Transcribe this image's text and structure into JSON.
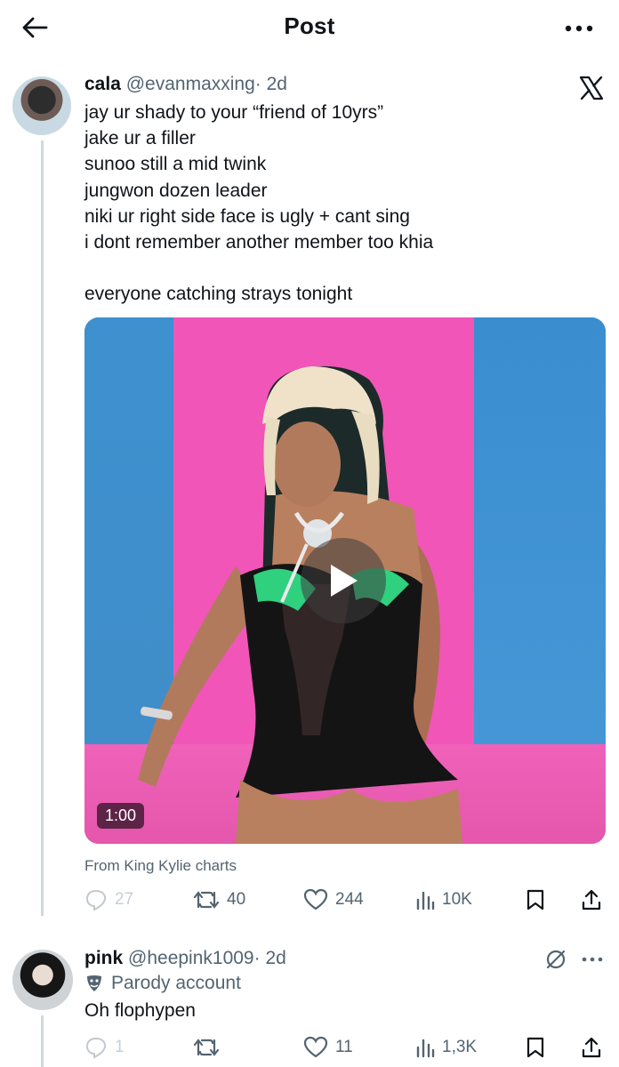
{
  "header": {
    "title": "Post"
  },
  "post": {
    "author_name": "cala",
    "author_handle": "@evanmaxxing",
    "time": "· 2d",
    "text": "jay ur shady to your “friend of 10yrs”\njake ur a filler\nsunoo still a mid twink\njungwon dozen leader\nniki ur right side face is ugly + cant sing\ni dont remember another member too khia\n\neveryone catching strays tonight",
    "media": {
      "duration": "1:00"
    },
    "from_text": "From King Kylie charts",
    "stats": {
      "replies": "27",
      "reposts": "40",
      "likes": "244",
      "views": "10K"
    }
  },
  "reply": {
    "author_name": "pink",
    "author_handle": "@heepink1009",
    "time": "· 2d",
    "badge": "Parody account",
    "text": "Oh flophypen",
    "stats": {
      "replies": "1",
      "reposts": "",
      "likes": "11",
      "views": "1,3K"
    }
  },
  "colors": {
    "text": "#0f1419",
    "secondary": "#536471",
    "thread_line": "#cfd9de",
    "pink_wall": "#f155b7",
    "blue_wall": "#3b8fcf"
  },
  "icons": [
    "back-arrow-icon",
    "more-icon",
    "x-logo-icon",
    "play-icon",
    "reply-icon",
    "repost-icon",
    "like-icon",
    "views-icon",
    "bookmark-icon",
    "share-icon",
    "grok-icon",
    "parody-mask-icon"
  ]
}
